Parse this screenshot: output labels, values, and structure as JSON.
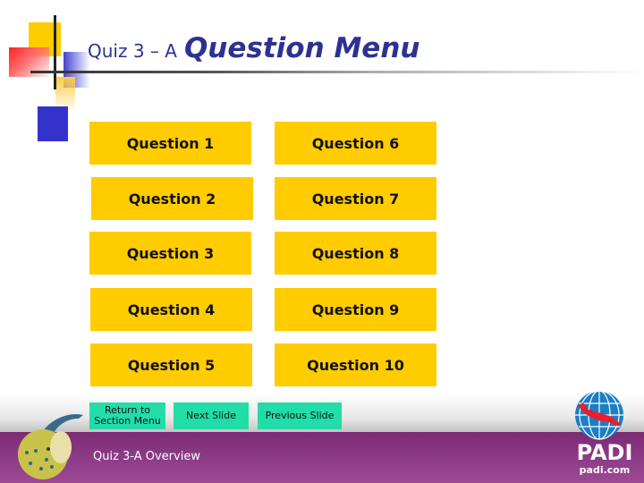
{
  "header": {
    "title_prefix": "Quiz 3 – A",
    "title_main": "Question Menu"
  },
  "questions": [
    {
      "label": "Question 1"
    },
    {
      "label": "Question 2"
    },
    {
      "label": "Question 3"
    },
    {
      "label": "Question 4"
    },
    {
      "label": "Question 5"
    },
    {
      "label": "Question 6"
    },
    {
      "label": "Question 7"
    },
    {
      "label": "Question 8"
    },
    {
      "label": "Question 9"
    },
    {
      "label": "Question 10"
    }
  ],
  "nav": {
    "return_line1": "Return to",
    "return_line2": "Section Menu",
    "next": "Next Slide",
    "previous": "Previous Slide"
  },
  "footer": {
    "overview": "Quiz 3-A Overview",
    "logo_text": "PADI",
    "logo_url_text": "padi.com"
  },
  "colors": {
    "title": "#2e3192",
    "question_button": "#ffcc00",
    "nav_button": "#22dda8",
    "footer": "#8c3b86"
  }
}
